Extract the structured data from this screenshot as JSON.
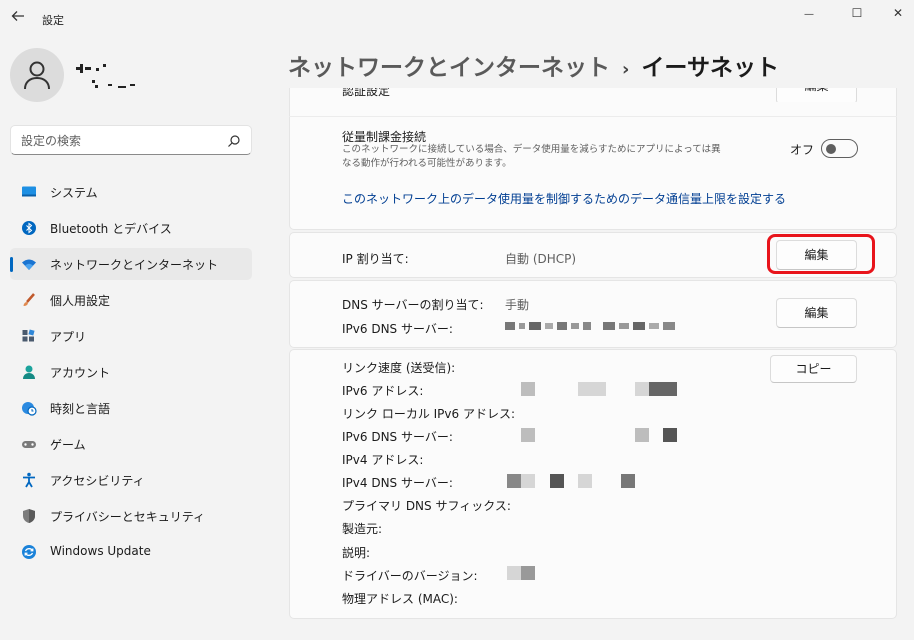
{
  "window": {
    "title": "設定",
    "back_icon": "arrow-left-icon",
    "minimize_glyph": "—",
    "maximize_glyph": "☐",
    "close_glyph": "✕"
  },
  "sidebar": {
    "search_placeholder": "設定の検索",
    "items": [
      {
        "label": "システム",
        "icon": "monitor-icon",
        "color": "#0078d4"
      },
      {
        "label": "Bluetooth とデバイス",
        "icon": "bluetooth-icon",
        "color": "#0067c0"
      },
      {
        "label": "ネットワークとインターネット",
        "icon": "wifi-icon",
        "color": "#0067c0",
        "active": true
      },
      {
        "label": "個人用設定",
        "icon": "brush-icon",
        "color": "#d1733a"
      },
      {
        "label": "アプリ",
        "icon": "apps-icon",
        "color": "#4a5a6e"
      },
      {
        "label": "アカウント",
        "icon": "person-icon",
        "color": "#1ba39c"
      },
      {
        "label": "時刻と言語",
        "icon": "globe-clock-icon",
        "color": "#0067c0"
      },
      {
        "label": "ゲーム",
        "icon": "gamepad-icon",
        "color": "#6b6b6b"
      },
      {
        "label": "アクセシビリティ",
        "icon": "accessibility-icon",
        "color": "#0067c0"
      },
      {
        "label": "プライバシーとセキュリティ",
        "icon": "shield-icon",
        "color": "#6b6b6b"
      },
      {
        "label": "Windows Update",
        "icon": "update-icon",
        "color": "#0078d4"
      }
    ]
  },
  "header": {
    "parent": "ネットワークとインターネット",
    "separator": "›",
    "current": "イーサネット"
  },
  "settings": {
    "auth": {
      "label": "認証設定",
      "button": "編集"
    },
    "metered": {
      "label": "従量制課金接続",
      "description": "このネットワークに接続している場合、データ使用量を減らすためにアプリによっては異なる動作が行われる可能性があります。",
      "toggle_label": "オフ",
      "toggle_on": false,
      "link": "このネットワーク上のデータ使用量を制御するためのデータ通信量上限を設定する"
    },
    "ip": {
      "label": "IP 割り当て:",
      "value": "自動 (DHCP)",
      "button": "編集"
    },
    "dns": {
      "label": "DNS サーバーの割り当て:",
      "value": "手動",
      "ipv6_label": "IPv6 DNS サーバー:",
      "button": "編集"
    },
    "details": {
      "copy_button": "コピー",
      "labels": [
        "リンク速度 (送受信):",
        "IPv6 アドレス:",
        "リンク ローカル IPv6 アドレス:",
        "IPv6 DNS サーバー:",
        "IPv4 アドレス:",
        "IPv4 DNS サーバー:",
        "プライマリ DNS サフィックス:",
        "製造元:",
        "説明:",
        "ドライバーのバージョン:",
        "物理アドレス (MAC):"
      ]
    }
  },
  "colors": {
    "accent": "#0067c0",
    "link": "#003e92",
    "highlight": "#e8141b"
  }
}
